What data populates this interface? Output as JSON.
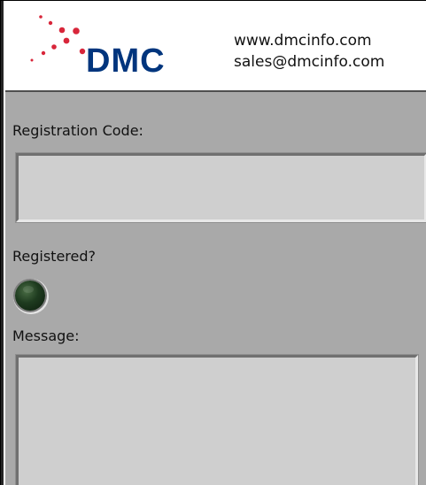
{
  "brand": {
    "name": "DMC",
    "website": "www.dmcinfo.com",
    "email": "sales@dmcinfo.com"
  },
  "registration": {
    "label": "Registration Code:",
    "value": ""
  },
  "status": {
    "label": "Registered?",
    "registered": false
  },
  "message": {
    "label": "Message:",
    "value": ""
  },
  "colors": {
    "logo_blue": "#00357d",
    "logo_red": "#d8263a",
    "panel_gray": "#a9a9a9",
    "field_gray": "#cfcfcf",
    "led_green": "#1e3b1f"
  },
  "icons": {
    "logo": "dmc-logo",
    "indicator": "registered-led-indicator"
  }
}
